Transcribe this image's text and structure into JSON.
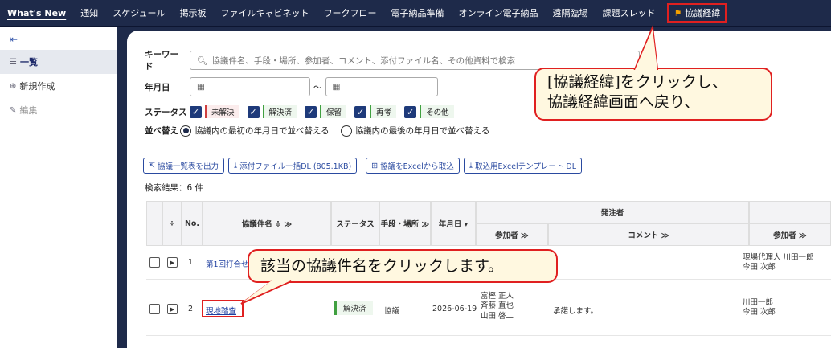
{
  "nav": {
    "items": [
      "What's New",
      "通知",
      "スケジュール",
      "掲示板",
      "ファイルキャビネット",
      "ワークフロー",
      "電子納品準備",
      "オンライン電子納品",
      "遠隔臨場",
      "課題スレッド"
    ],
    "current": "協議経緯"
  },
  "sidebar": {
    "collapse": "⇤",
    "list": "一覧",
    "new": "新規作成",
    "edit": "編集"
  },
  "search": {
    "keyword_label": "キーワード",
    "keyword_placeholder": "協議件名、手段・場所、参加者、コメント、添付ファイル名、その他資料で検索",
    "date_label": "年月日",
    "date_sep": "～",
    "status_label": "ステータス",
    "statuses": [
      "未解決",
      "解決済",
      "保留",
      "再考",
      "その他"
    ],
    "status_colors": [
      "#d04040",
      "#40a040",
      "#40a040",
      "#40a040",
      "#40a040"
    ],
    "sort_label": "並べ替え",
    "sort_first": "協議内の最初の年月日で並べ替える",
    "sort_last": "協議内の最後の年月日で並べ替える"
  },
  "actions": {
    "export": "協議一覧表を出力",
    "download": "添付ファイル一括DL (805.1KB)",
    "import": "協議をExcelから取込",
    "template": "取込用Excelテンプレート DL"
  },
  "results": {
    "count": "検索結果：6 件"
  },
  "table": {
    "headers": {
      "no": "No.",
      "title": "協議件名 ≑ ≫",
      "status": "ステータス",
      "means": "手段・場所 ≫",
      "date": "年月日 ▾",
      "orderer": "発注者",
      "participants": "参加者 ≫",
      "comment": "コメント ≫",
      "participants2": "参加者 ≫"
    },
    "rows": [
      {
        "no": "1",
        "title": "第1回打合せ",
        "status": "",
        "means": "",
        "date": "",
        "participants": "",
        "comment": "",
        "participants2": "現場代理人 川田一郎\n今田 次郎"
      },
      {
        "no": "2",
        "title": "現地踏査",
        "status": "解決済",
        "means": "協議",
        "date": "2026-06-19",
        "participants": "富樫 正人\n斉藤 直也\n山田 啓二",
        "comment": "承諾します。",
        "participants2": "川田一郎\n今田 次郎"
      }
    ]
  },
  "callouts": {
    "top": "[協議経緯]をクリックし、\n協議経緯画面へ戻り、",
    "bottom": "該当の協議件名をクリックします。"
  }
}
